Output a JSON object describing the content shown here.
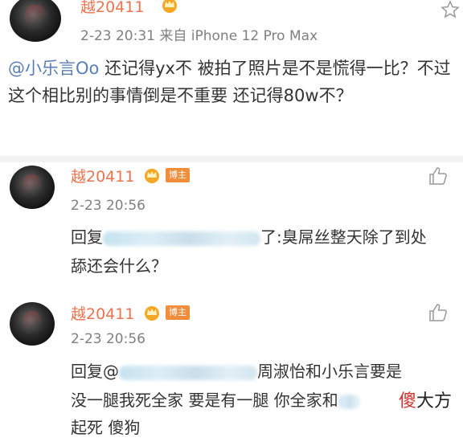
{
  "post": {
    "author": "越20411",
    "meta": "2-23 20:31  来自 iPhone 12 Pro Max",
    "mention": "@小乐言Oo",
    "text": " 还记得yx不 被拍了照片是不是慌得一比？不过这个相比别的事情倒是不重要 还记得80w不？"
  },
  "comments": [
    {
      "author": "越20411",
      "badge": "博主",
      "time": "2-23 20:56",
      "reply_prefix": "回复",
      "reply_suffix": "了:臭屌丝整天除了到处",
      "line2": "舔还会什么？"
    },
    {
      "author": "越20411",
      "badge": "博主",
      "time": "2-23 20:56",
      "reply_prefix": "回复@",
      "reply_suffix": "周淑怡和小乐言要是",
      "line2": "没一腿我死全家 要是有一腿 你全家和",
      "line3": "起死 傻狗"
    }
  ],
  "watermark": {
    "red": "傻",
    "rest": "大方"
  },
  "icons": {
    "star": "star-outline-icon",
    "like": "thumbs-up-icon",
    "crown": "vip-crown-icon"
  },
  "colors": {
    "name": "#eb7350",
    "mention": "#5a7fb5",
    "badge": "#f28d3c"
  }
}
